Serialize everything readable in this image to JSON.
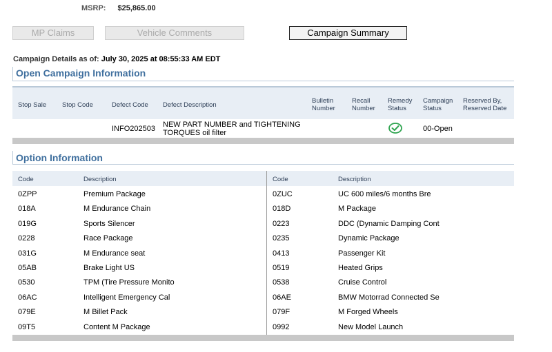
{
  "msrp": {
    "label": "MSRP:",
    "value": "$25,865.00"
  },
  "buttons": {
    "mp_claims": "MP Claims",
    "vehicle_comments": "Vehicle Comments",
    "campaign_summary": "Campaign Summary"
  },
  "as_of": {
    "label": "Campaign Details as of:",
    "value": "July 30, 2025 at 08:55:33 AM EDT"
  },
  "open_campaign": {
    "title": "Open Campaign Information",
    "headers": {
      "stop_sale": "Stop Sale",
      "stop_code": "Stop Code",
      "defect_code": "Defect Code",
      "defect_description": "Defect Description",
      "bulletin_number_1": "Bulletin",
      "bulletin_number_2": "Number",
      "recall_number_1": "Recall",
      "recall_number_2": "Number",
      "remedy_status_1": "Remedy",
      "remedy_status_2": "Status",
      "campaign_status_1": "Campaign",
      "campaign_status_2": "Status",
      "reserved_by_1": "Reserved By,",
      "reserved_by_2": "Reserved Date"
    },
    "row": {
      "stop_sale": "",
      "stop_code": "",
      "defect_code": "INFO202503",
      "defect_description_1": "NEW PART NUMBER and TIGHTENING",
      "defect_description_2": "TORQUES oil filter",
      "bulletin_number": "",
      "recall_number": "",
      "remedy_status_icon": "check-circle-icon",
      "campaign_status": "00-Open",
      "reserved_by": ""
    }
  },
  "option_info": {
    "title": "Option Information",
    "headers": {
      "code": "Code",
      "description": "Description"
    },
    "rows": [
      {
        "code_l": "0ZPP",
        "desc_l": "Premium Package",
        "code_r": "0ZUC",
        "desc_r": "UC 600 miles/6 months Bre"
      },
      {
        "code_l": "018A",
        "desc_l": "M Endurance Chain",
        "code_r": "018D",
        "desc_r": "M Package"
      },
      {
        "code_l": "019G",
        "desc_l": "Sports Silencer",
        "code_r": "0223",
        "desc_r": "DDC (Dynamic Damping Cont"
      },
      {
        "code_l": "0228",
        "desc_l": "Race Package",
        "code_r": "0235",
        "desc_r": "Dynamic Package"
      },
      {
        "code_l": "031G",
        "desc_l": "M Endurance seat",
        "code_r": "0413",
        "desc_r": "Passenger Kit"
      },
      {
        "code_l": "05AB",
        "desc_l": "Brake Light US",
        "code_r": "0519",
        "desc_r": "Heated Grips"
      },
      {
        "code_l": "0530",
        "desc_l": "TPM (Tire Pressure Monito",
        "code_r": "0538",
        "desc_r": "Cruise Control"
      },
      {
        "code_l": "06AC",
        "desc_l": "Intelligent Emergency Cal",
        "code_r": "06AE",
        "desc_r": "BMW Motorrad Connected Se"
      },
      {
        "code_l": "079E",
        "desc_l": "M Billet Pack",
        "code_r": "079F",
        "desc_r": "M Forged Wheels"
      },
      {
        "code_l": "09T5",
        "desc_l": "Content M Package",
        "code_r": "0992",
        "desc_r": "New Model Launch"
      }
    ]
  },
  "colors": {
    "accent": "#3f6f9e",
    "header_bg": "#e8eef5",
    "check": "#2ea44f"
  }
}
